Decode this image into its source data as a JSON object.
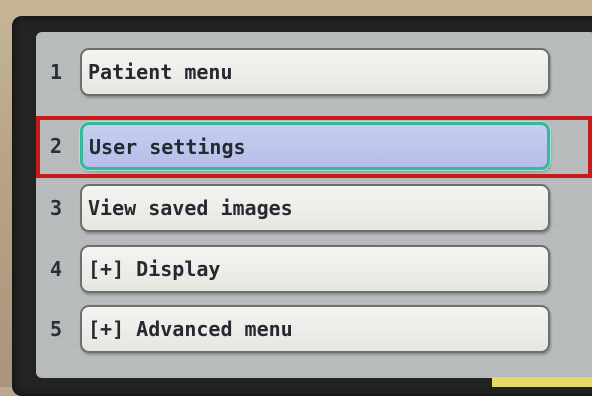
{
  "menu": {
    "items": [
      {
        "number": "1",
        "label": "Patient menu"
      },
      {
        "number": "2",
        "label": "User settings",
        "selected": true
      },
      {
        "number": "3",
        "label": "View saved images"
      },
      {
        "number": "4",
        "label": "[+] Display"
      },
      {
        "number": "5",
        "label": "[+] Advanced menu"
      }
    ]
  },
  "colors": {
    "selection_outline": "#38b79a",
    "selection_fill": "#b4bee9",
    "annotation_box": "#c8191b"
  }
}
